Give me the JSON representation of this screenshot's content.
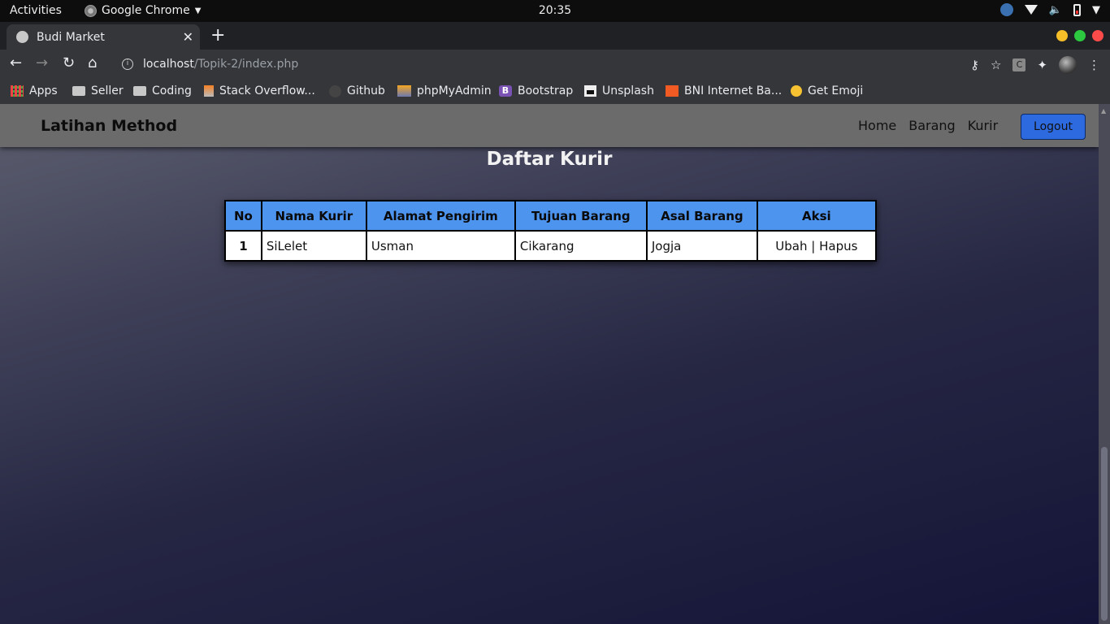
{
  "system": {
    "activities": "Activities",
    "app_name": "Google Chrome",
    "clock": "20:35"
  },
  "browser": {
    "tab_title": "Budi Market",
    "url_host": "localhost",
    "url_path": "/Topik-2/index.php",
    "bookmarks": [
      {
        "label": "Apps",
        "icon": "apps-grid-icon"
      },
      {
        "label": "Seller",
        "icon": "folder-icon"
      },
      {
        "label": "Coding",
        "icon": "folder-icon"
      },
      {
        "label": "Stack Overflow...",
        "icon": "stackoverflow-icon"
      },
      {
        "label": "Github",
        "icon": "github-icon"
      },
      {
        "label": "phpMyAdmin",
        "icon": "phpmyadmin-icon"
      },
      {
        "label": "Bootstrap",
        "icon": "bootstrap-icon"
      },
      {
        "label": "Unsplash",
        "icon": "unsplash-icon"
      },
      {
        "label": "BNI Internet Ba...",
        "icon": "bni-icon"
      },
      {
        "label": "Get Emoji",
        "icon": "emoji-icon"
      }
    ]
  },
  "site": {
    "brand": "Latihan Method",
    "nav": [
      "Home",
      "Barang",
      "Kurir"
    ],
    "logout": "Logout",
    "page_title": "Daftar Kurir",
    "table": {
      "headers": [
        "No",
        "Nama Kurir",
        "Alamat Pengirim",
        "Tujuan Barang",
        "Asal Barang",
        "Aksi"
      ],
      "rows": [
        {
          "no": "1",
          "nama": "SiLelet",
          "alamat": "Usman",
          "tujuan": "Cikarang",
          "asal": "Jogja",
          "ubah": "Ubah",
          "sep": " | ",
          "hapus": "Hapus"
        }
      ]
    }
  },
  "colors": {
    "header_bg": "#4d94ef",
    "logout_bg": "#2d6ae0",
    "action_link": "#f07070"
  }
}
